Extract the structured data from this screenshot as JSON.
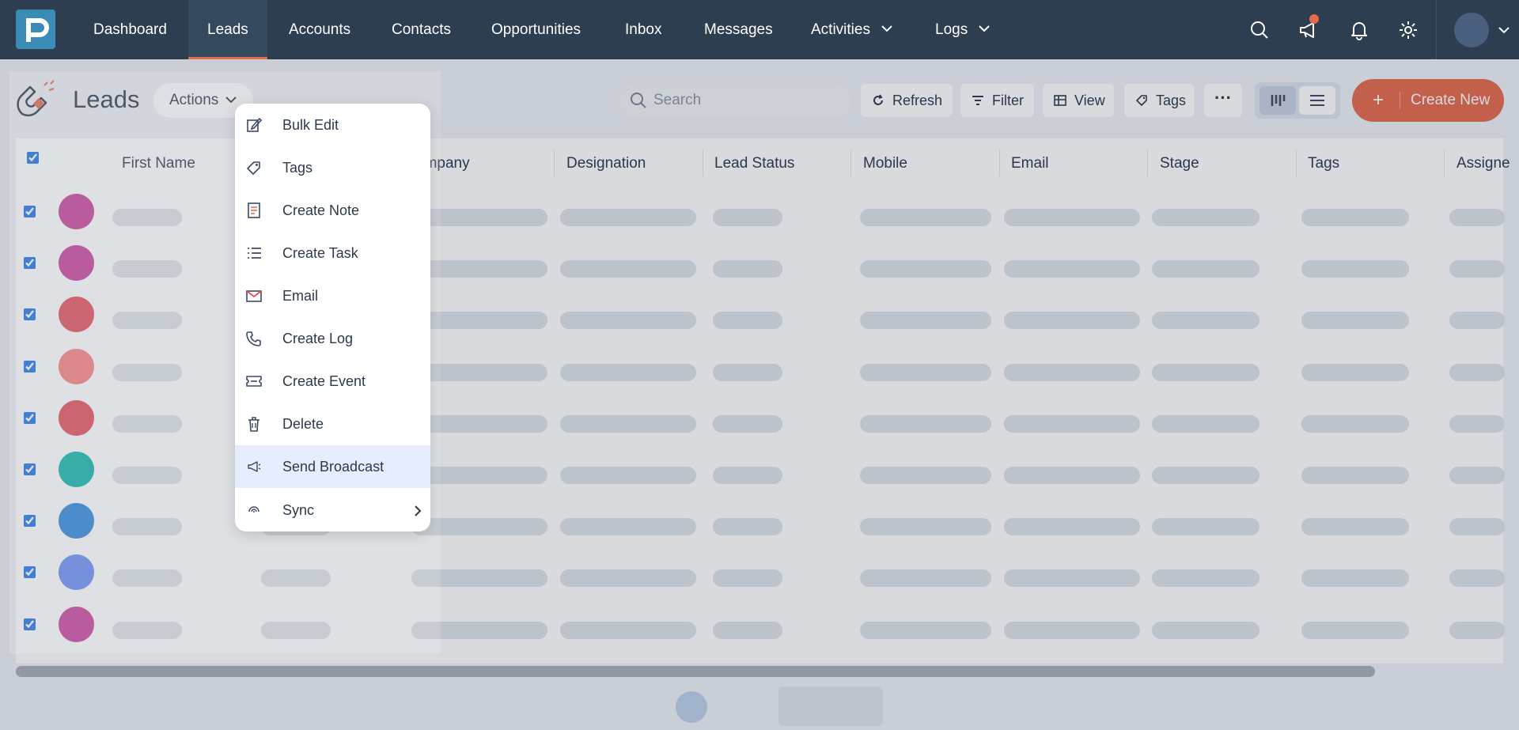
{
  "nav": {
    "items": [
      {
        "label": "Dashboard"
      },
      {
        "label": "Leads"
      },
      {
        "label": "Accounts"
      },
      {
        "label": "Contacts"
      },
      {
        "label": "Opportunities"
      },
      {
        "label": "Inbox"
      },
      {
        "label": "Messages"
      },
      {
        "label": "Activities"
      },
      {
        "label": "Logs"
      }
    ],
    "active": "Leads",
    "icons": [
      "search-icon",
      "megaphone-icon",
      "bell-icon",
      "gear-icon"
    ]
  },
  "page": {
    "title": "Leads",
    "actions_label": "Actions"
  },
  "toolbar": {
    "search_placeholder": "Search",
    "refresh_label": "Refresh",
    "filter_label": "Filter",
    "view_label": "View",
    "tags_label": "Tags",
    "create_label": "Create New"
  },
  "table": {
    "columns": [
      "First Name",
      "Company",
      "Designation",
      "Lead Status",
      "Mobile",
      "Email",
      "Stage",
      "Tags",
      "Assigne"
    ],
    "visible_columns": [
      "First Name",
      "ompany",
      "Designation",
      "Lead Status",
      "Mobile",
      "Email",
      "Stage",
      "Tags",
      "Assigne"
    ],
    "rows": [
      {
        "checked": true,
        "avatar_color": "#c8409a"
      },
      {
        "checked": true,
        "avatar_color": "#c8409a"
      },
      {
        "checked": true,
        "avatar_color": "#e64e5c"
      },
      {
        "checked": true,
        "avatar_color": "#fc8181"
      },
      {
        "checked": true,
        "avatar_color": "#e64e5c"
      },
      {
        "checked": true,
        "avatar_color": "#0eb5a8"
      },
      {
        "checked": true,
        "avatar_color": "#2d86dd"
      },
      {
        "checked": true,
        "avatar_color": "#6b8cf5"
      },
      {
        "checked": true,
        "avatar_color": "#c8409a"
      }
    ]
  },
  "actions_menu": {
    "items": [
      {
        "label": "Bulk Edit",
        "icon": "edit-icon"
      },
      {
        "label": "Tags",
        "icon": "tag-icon"
      },
      {
        "label": "Create Note",
        "icon": "note-icon"
      },
      {
        "label": "Create Task",
        "icon": "task-list-icon"
      },
      {
        "label": "Email",
        "icon": "envelope-icon"
      },
      {
        "label": "Create Log",
        "icon": "phone-icon"
      },
      {
        "label": "Create Event",
        "icon": "ticket-icon"
      },
      {
        "label": "Delete",
        "icon": "trash-icon"
      },
      {
        "label": "Send Broadcast",
        "icon": "megaphone-icon"
      },
      {
        "label": "Sync",
        "icon": "sync-icon"
      }
    ],
    "highlighted": "Send Broadcast"
  },
  "colors": {
    "nav_bg": "#2c3e50",
    "accent": "#e46b4d",
    "checkbox": "#1a73e8"
  }
}
